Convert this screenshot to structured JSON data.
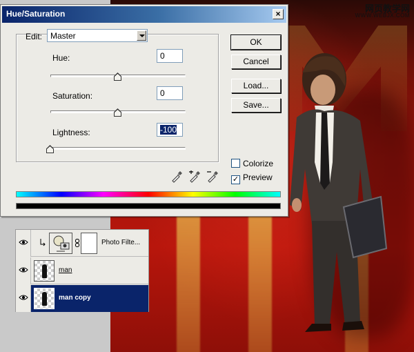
{
  "watermark": {
    "main": "网页教学网",
    "sub": "WWW.WEBJX.COM"
  },
  "dialog": {
    "title": "Hue/Saturation",
    "close_glyph": "×",
    "edit": {
      "label": "Edit:",
      "value": "Master"
    },
    "hue": {
      "label": "Hue:",
      "value": "0",
      "slider_position": 0.5
    },
    "saturation": {
      "label": "Saturation:",
      "value": "0",
      "slider_position": 0.5
    },
    "lightness": {
      "label": "Lightness:",
      "value": "-100",
      "slider_position": 0.0
    },
    "buttons": {
      "ok": "OK",
      "cancel": "Cancel",
      "load": "Load...",
      "save": "Save..."
    },
    "colorize": {
      "label": "Colorize",
      "checked": false
    },
    "preview": {
      "label": "Preview",
      "checked": true,
      "check_glyph": "✓"
    }
  },
  "layers": [
    {
      "name": "Photo Filte...",
      "type": "adjustment",
      "selected": false
    },
    {
      "name": "man",
      "type": "pixel",
      "selected": false
    },
    {
      "name": "man copy",
      "type": "pixel",
      "selected": true
    }
  ],
  "colors": {
    "title_gradient_start": "#0a246a",
    "title_gradient_end": "#a6caf0",
    "selection": "#0a246a",
    "dialog_bg": "#ecebe6",
    "photo_red": "#b8160c"
  }
}
